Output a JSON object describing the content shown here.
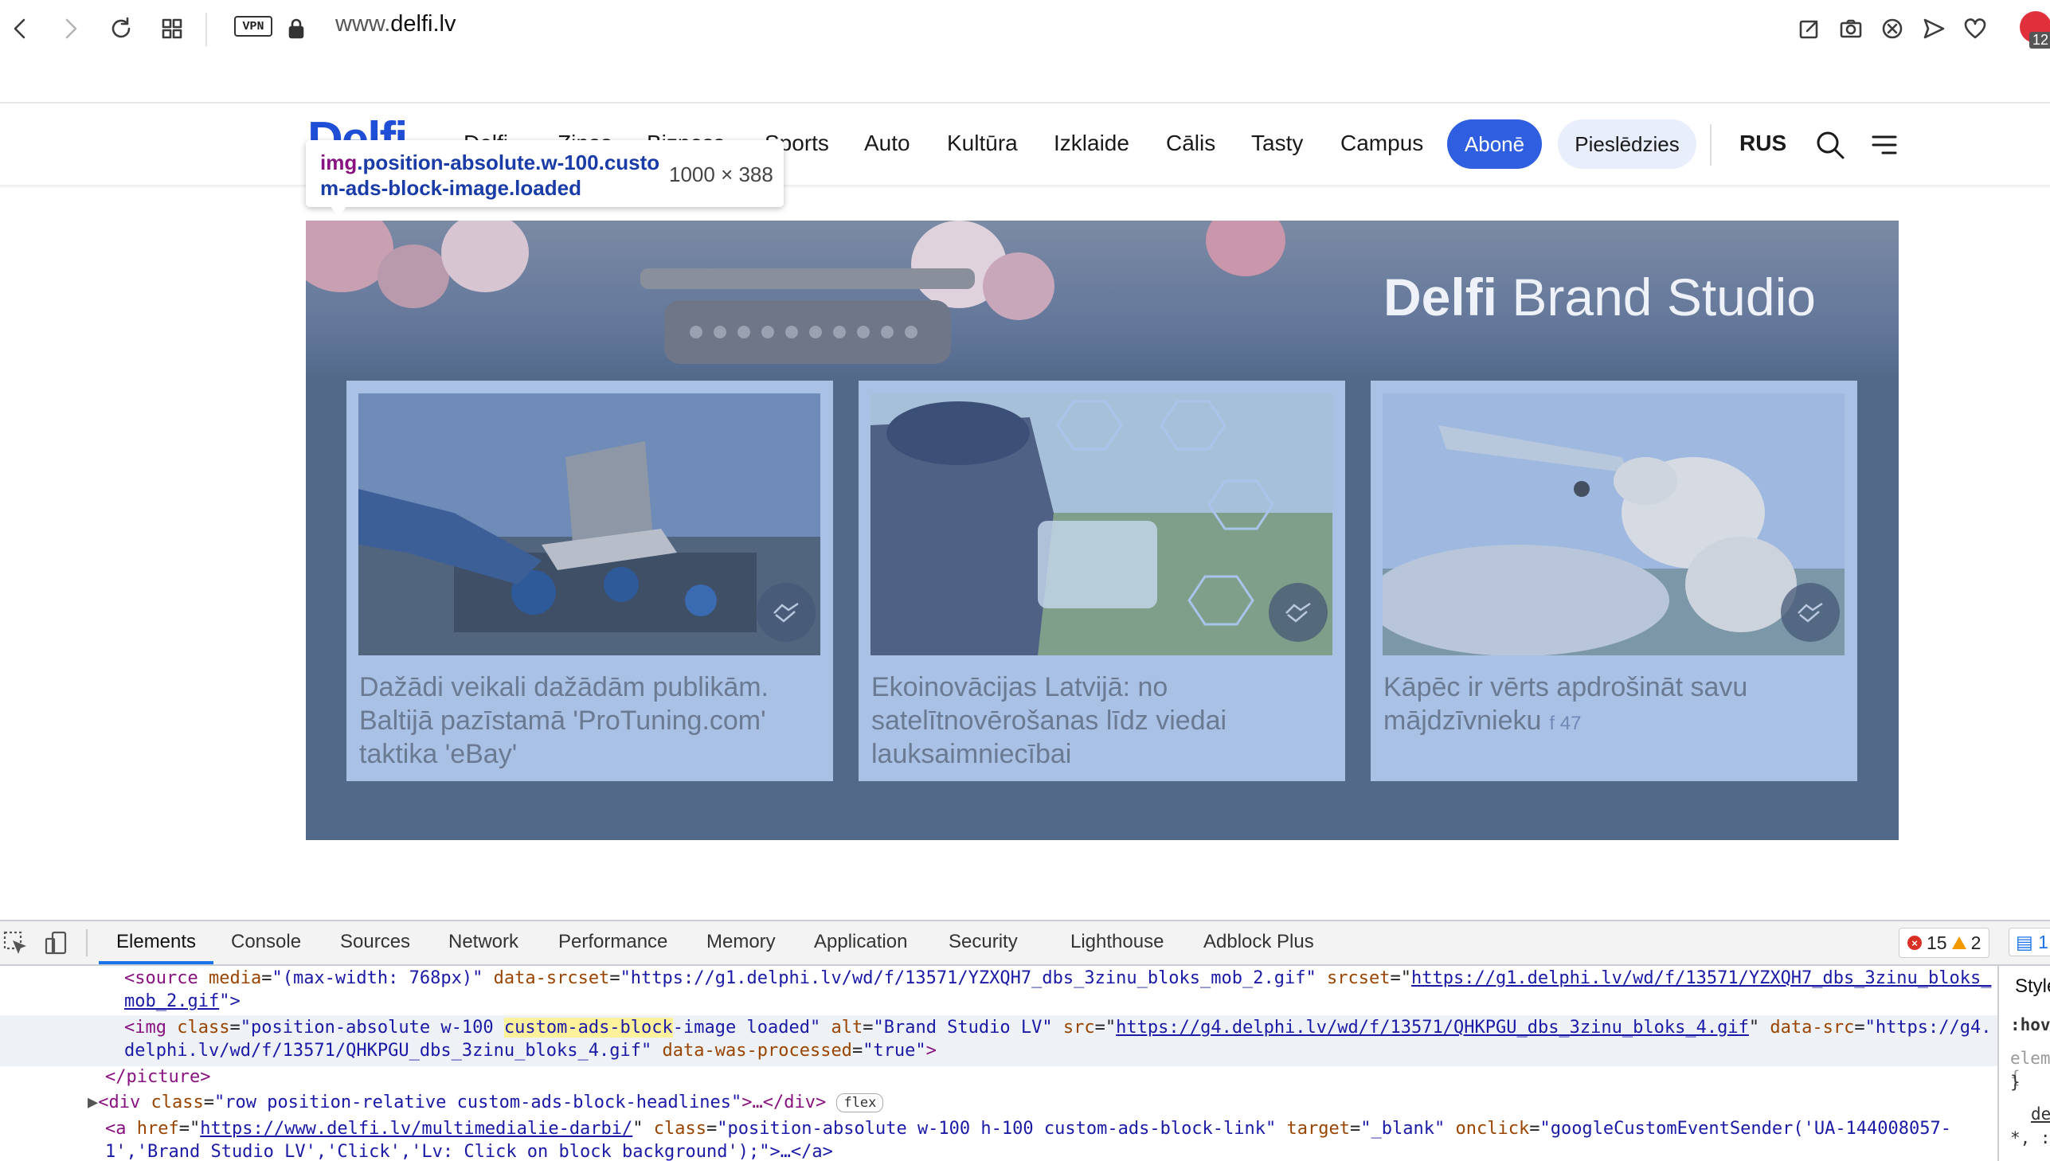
{
  "browser": {
    "url_prefix": "www.",
    "url_domain": "delfi.lv",
    "vpn_label": "VPN",
    "adblock_count": "12"
  },
  "site": {
    "logo": "Delfi",
    "nav_items": [
      "Delfi",
      "Ziņas",
      "Bizness",
      "Sports",
      "Auto",
      "Kultūra",
      "Izklaide",
      "Cālis",
      "Tasty",
      "Campus"
    ],
    "subscribe_label": "Abonē",
    "login_label": "Pieslēdzies",
    "language_label": "RUS"
  },
  "inspect_tooltip": {
    "tag": "img",
    "selector": ".position-absolute.w-100.custom-ads-block-image.loaded",
    "size": "1000 × 388"
  },
  "brand_block": {
    "title_bold": "Delfi",
    "title_rest": " Brand Studio",
    "cards": [
      {
        "title": "Dažādi veikali dažādām publikām. Baltijā pazīstamā 'ProTuning.com' taktika 'eBay'",
        "fb_count": ""
      },
      {
        "title": "Ekoinovācijas Latvijā: no satelītnovērošanas līdz viedai lauksaimniecībai",
        "fb_count": ""
      },
      {
        "title": "Kāpēc ir vērts apdrošināt savu mājdzīvnieku",
        "fb_count": "47"
      }
    ]
  },
  "devtools": {
    "tabs": [
      "Elements",
      "Console",
      "Sources",
      "Network",
      "Performance",
      "Memory",
      "Application",
      "Security",
      "Lighthouse",
      "Adblock Plus"
    ],
    "error_count": "15",
    "warning_count": "2",
    "message_count": "1",
    "styles_tab": "Styles",
    "styles_hov": ":hov",
    "styles_elem": "element.style {",
    "styles_close": "}",
    "styles_de": "de",
    "styles_star": "*, :",
    "dom": {
      "l1_tag_open": "<source ",
      "l1_a1": "media",
      "l1_v1": "\"(max-width: 768px)\"",
      "l1_a2": "data-srcset",
      "l1_v2": "\"https://g1.delphi.lv/wd/f/13571/YZXQH7_dbs_3zinu_bloks_mob_2.gif\"",
      "l1_a3": "srcset",
      "l1_link1": "https://g1.delphi.lv/wd/f/13571/YZXQH7_dbs_3zinu_bloks_",
      "l1_link2": "mob_2.gif",
      "l1_close": "\">",
      "l2_tag_open": "<img ",
      "l2_a1": "class",
      "l2_v1_pre": "\"position-absolute w-100 ",
      "l2_v1_hl": "custom-ads-block",
      "l2_v1_post": "-image loaded\"",
      "l2_a2": "alt",
      "l2_v2": "\"Brand Studio LV\"",
      "l2_a3": "src",
      "l2_link": "https://g4.delphi.lv/wd/f/13571/QHKPGU_dbs_3zinu_bloks_4.gif",
      "l2_a4": "data-src",
      "l2_v4a": "\"https://g4.",
      "l2_v4b": "delphi.lv/wd/f/13571/QHKPGU_dbs_3zinu_bloks_4.gif\"",
      "l2_a5": "data-was-processed",
      "l2_v5": "\"true\"",
      "l3": "</picture>",
      "l4_tag": "<div ",
      "l4_a1": "class",
      "l4_v1": "\"row position-relative custom-ads-block-headlines\"",
      "l4_rest": ">…</div>",
      "l4_badge": "flex",
      "l5_tag": "<a ",
      "l5_a1": "href",
      "l5_link": "https://www.delfi.lv/multimedialie-darbi/",
      "l5_a2": "class",
      "l5_v2": "\"position-absolute w-100 h-100 custom-ads-block-link\"",
      "l5_a3": "target",
      "l5_v3": "\"_blank\"",
      "l5_a4": "onclick",
      "l5_v4": "\"googleCustomEventSender('UA-144008057-",
      "l6": "1','Brand Studio LV','Click','Lv: Click on block background');\">…</a>"
    }
  },
  "colors": {
    "accent_blue": "#2f5fe0",
    "block_bg": "#52698a",
    "card_bg": "#a9c1e4",
    "highlight": "#fdf29b"
  }
}
